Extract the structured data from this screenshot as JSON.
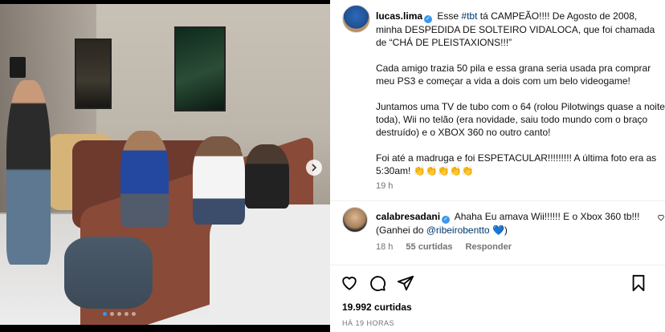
{
  "post": {
    "author": "lucas.lima",
    "caption_hashtag": "#tbt",
    "caption_line1_pre": "Esse",
    "caption_line1_post": "tá CAMPEÃO!!!! De Agosto de 2008, minha DESPEDIDA DE SOLTEIRO VIDALOCA, que foi chamada de “CHÁ DE PLEISTAXIONS!!!”",
    "caption_p2": "Cada amigo trazia 50 pila e essa grana seria usada pra comprar meu PS3 e começar a vida a dois com um belo videogame!",
    "caption_p3": "Juntamos uma TV de tubo com o 64 (rolou Pilotwings quase a noite toda), Wii no telão (era novidade, saiu todo mundo com o braço destruído) e o XBOX 360 no outro canto!",
    "caption_p4": "Foi até a madruga e foi ESPETACULAR!!!!!!!!! A última foto era as 5:30am! 👏👏👏👏👏",
    "caption_age": "19 h"
  },
  "comment": {
    "author": "calabresadani",
    "text_pre": "Ahaha Eu amava Wii!!!!!! E o Xbox 360 tb!!! (Ganhei do",
    "mention": "@ribeirobentto",
    "text_post": "💙)",
    "age": "18 h",
    "likes": "55 curtidas",
    "reply": "Responder"
  },
  "stats": {
    "likes": "19.992 curtidas",
    "time": "HÁ 19 HORAS"
  },
  "icons": {
    "like": "heart-icon",
    "comment": "comment-icon",
    "share": "send-icon",
    "save": "bookmark-icon",
    "next": "chevron-right-icon"
  },
  "carousel": {
    "total_slides": 5,
    "active_slide": 1
  }
}
